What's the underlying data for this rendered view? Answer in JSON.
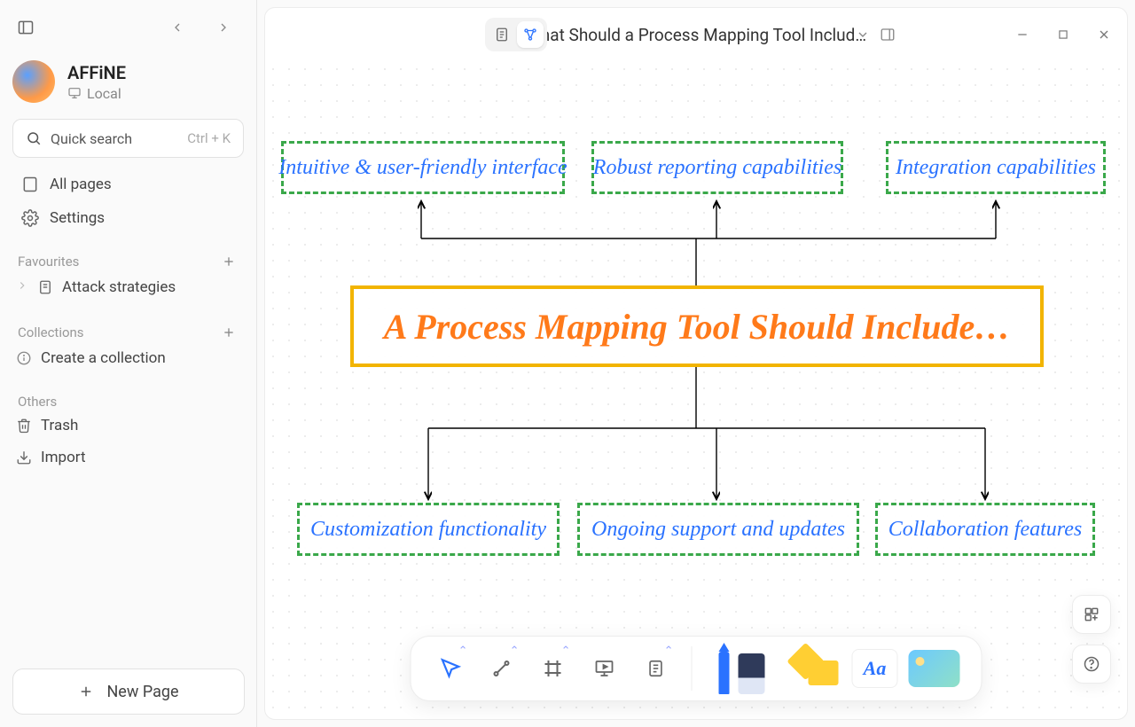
{
  "workspace": {
    "name": "AFFiNE",
    "location": "Local"
  },
  "search": {
    "placeholder": "Quick search",
    "shortcut": "Ctrl + K"
  },
  "nav": {
    "all_pages": "All pages",
    "settings": "Settings"
  },
  "sections": {
    "favourites": {
      "title": "Favourites",
      "items": [
        "Attack strategies"
      ]
    },
    "collections": {
      "title": "Collections",
      "create": "Create a collection"
    },
    "others": {
      "title": "Others",
      "trash": "Trash",
      "import": "Import"
    }
  },
  "new_page": "New Page",
  "header": {
    "title": "What Should a Process Mapping Tool Includ…"
  },
  "diagram": {
    "center": "A Process Mapping Tool Should Include…",
    "top": [
      "Intuitive & user-friendly interface",
      "Robust reporting capabilities",
      "Integration capabilities"
    ],
    "bottom": [
      "Customization functionality",
      "Ongoing support and updates",
      "Collaboration features"
    ]
  },
  "toolbar": {
    "select": "select",
    "connector": "connector",
    "frame": "frame",
    "present": "present",
    "note": "note",
    "pen": "pen",
    "shapes": "shapes",
    "text": "Aa",
    "image": "image"
  }
}
